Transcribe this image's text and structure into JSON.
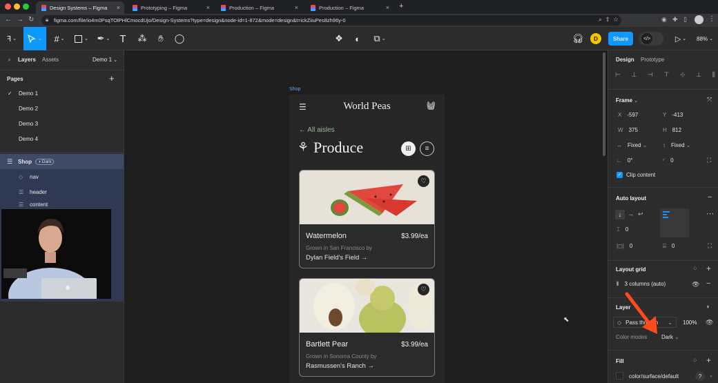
{
  "browser": {
    "tabs": [
      {
        "title": "Design Systems – Figma",
        "active": true
      },
      {
        "title": "Prototyping – Figma",
        "active": false
      },
      {
        "title": "Production – Figma",
        "active": false
      },
      {
        "title": "Production – Figma",
        "active": false
      }
    ],
    "new_tab": "+",
    "url": "figma.com/file/io4m0PsqTOlPHlCmocdUjo/Design-Systems?type=design&node-id=1-872&mode=design&t=ickZiiuPes8zh96y-0"
  },
  "toolbar": {
    "share_label": "Share",
    "avatar_letter": "D",
    "zoom": "88%",
    "dev_mode_label": "</>"
  },
  "left_panel": {
    "tabs": [
      "Layers",
      "Assets"
    ],
    "page_selector": "Demo 1",
    "pages_title": "Pages",
    "add_page": "+",
    "pages": [
      "Demo 1",
      "Demo 2",
      "Demo 3",
      "Demo 4"
    ],
    "current_page": "Demo 1",
    "layers": [
      {
        "name": "Shop",
        "badge": "Dark"
      },
      {
        "name": "nav"
      },
      {
        "name": "header"
      },
      {
        "name": "content"
      }
    ]
  },
  "canvas": {
    "frame_label": "Shop",
    "app": {
      "brand": "World Peas",
      "back_link": "← All aisles",
      "category": "Produce",
      "products": [
        {
          "name": "Watermelon",
          "price": "$3.99/ea",
          "origin": "Grown in San Francisco by",
          "farm": "Dylan Field's Field →"
        },
        {
          "name": "Bartlett Pear",
          "price": "$3.99/ea",
          "origin": "Grown in Sonoma County by",
          "farm": "Rasmussen's Ranch →"
        }
      ]
    }
  },
  "right_panel": {
    "tabs": [
      "Design",
      "Prototype"
    ],
    "frame": {
      "title": "Frame",
      "x_label": "X",
      "x": "-597",
      "y_label": "Y",
      "y": "-413",
      "w_label": "W",
      "w": "375",
      "h_label": "H",
      "h": "812",
      "h_sizing": "Fixed",
      "v_sizing": "Fixed",
      "rotation": "0°",
      "radius": "0",
      "clip_content": "Clip content"
    },
    "auto_layout": {
      "title": "Auto layout",
      "gap": "0",
      "padding_h": "0",
      "padding_v": "0"
    },
    "layout_grid": {
      "title": "Layout grid",
      "value": "3 columns (auto)"
    },
    "layer": {
      "title": "Layer",
      "blend": "Pass through",
      "opacity": "100%",
      "color_modes_label": "Color modes",
      "color_mode": "Dark"
    },
    "fill": {
      "title": "Fill",
      "value": "color/surface/default",
      "help": "?"
    }
  },
  "colors": {
    "accent": "#0d99ff",
    "annotation_arrow": "#ff4a1c",
    "avatar": "#f5c400",
    "link_green": "#8fbf9a"
  }
}
